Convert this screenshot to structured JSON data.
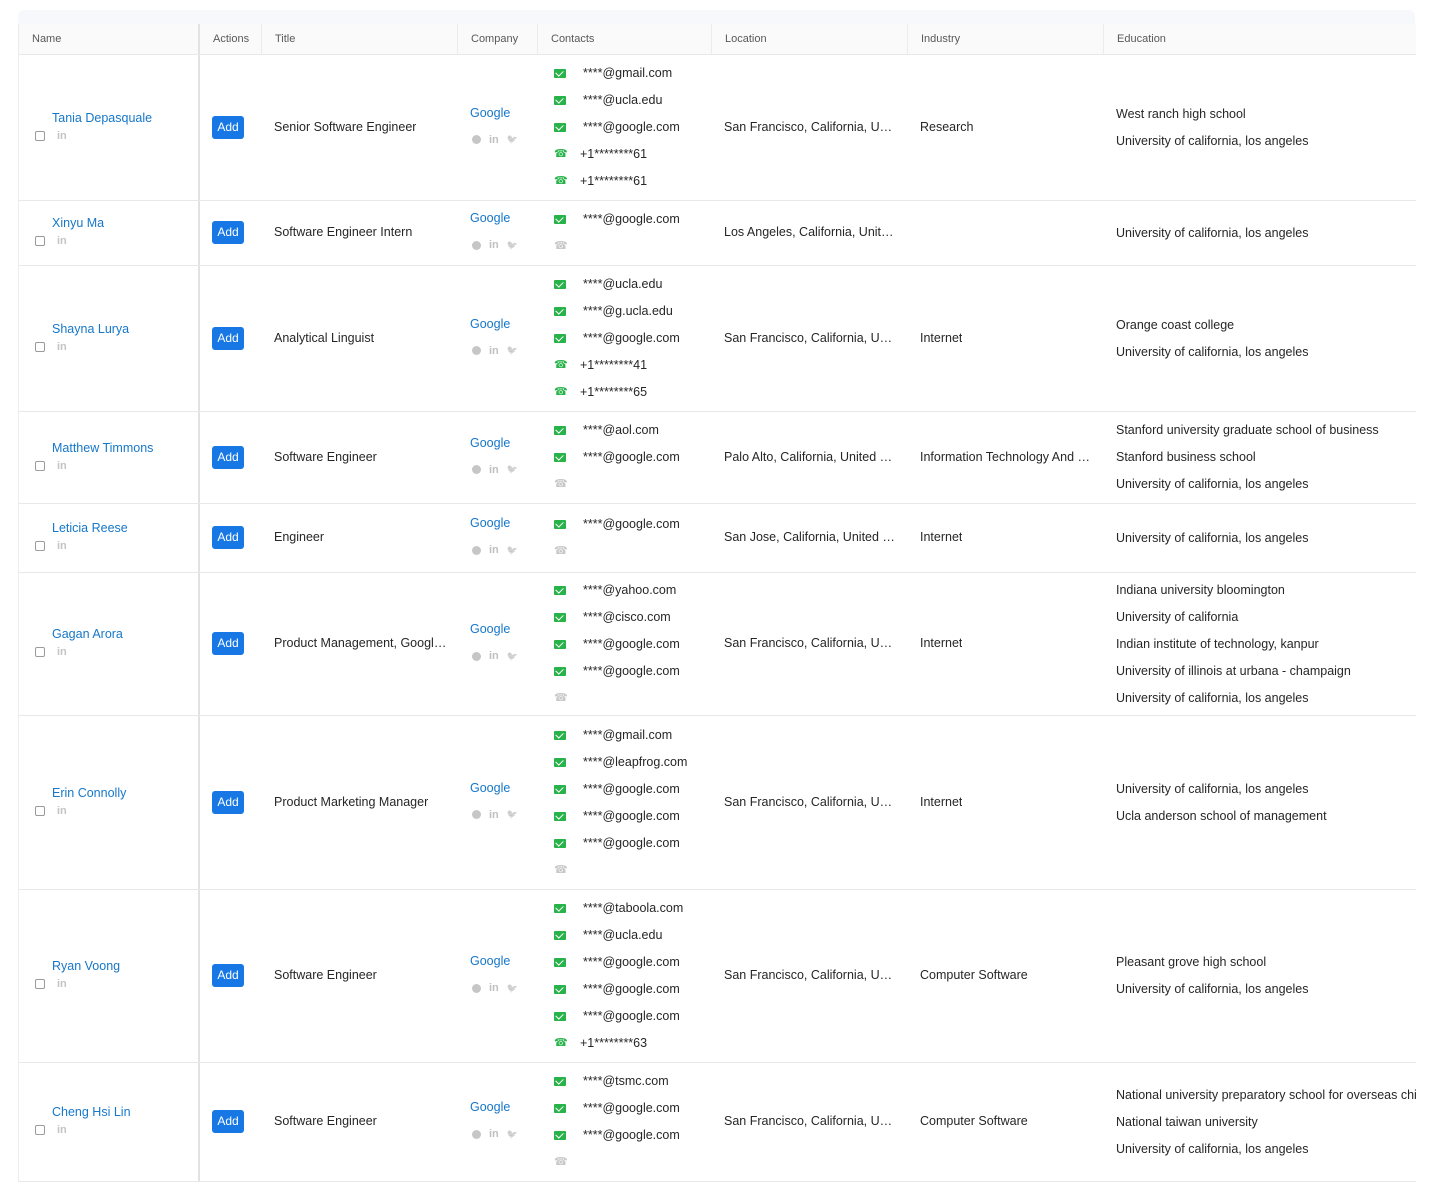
{
  "columns": [
    "Name",
    "Actions",
    "Title",
    "Company",
    "Contacts",
    "Location",
    "Industry",
    "Education"
  ],
  "add_label": "Add",
  "linkedin_label": "in",
  "rows": [
    {
      "name": "Tania Depasquale",
      "title": "Senior Software Engineer",
      "company": "Google",
      "contacts": [
        {
          "t": "mail",
          "v": "****@gmail.com"
        },
        {
          "t": "mail",
          "v": "****@ucla.edu"
        },
        {
          "t": "mail",
          "v": "****@google.com"
        },
        {
          "t": "phone",
          "v": "+1********61"
        },
        {
          "t": "phone",
          "v": "+1********61"
        }
      ],
      "location": "San Francisco, California, Un…",
      "industry": "Research",
      "education": [
        "West ranch high school",
        "University of california, los angeles"
      ]
    },
    {
      "name": "Xinyu Ma",
      "title": "Software Engineer Intern",
      "company": "Google",
      "contacts": [
        {
          "t": "mail",
          "v": "****@google.com"
        },
        {
          "t": "phone-empty",
          "v": ""
        }
      ],
      "location": "Los Angeles, California, Unit…",
      "industry": "",
      "education": [
        "University of california, los angeles"
      ]
    },
    {
      "name": "Shayna Lurya",
      "title": "Analytical Linguist",
      "company": "Google",
      "contacts": [
        {
          "t": "mail",
          "v": "****@ucla.edu"
        },
        {
          "t": "mail",
          "v": "****@g.ucla.edu"
        },
        {
          "t": "mail",
          "v": "****@google.com"
        },
        {
          "t": "phone",
          "v": "+1********41"
        },
        {
          "t": "phone",
          "v": "+1********65"
        }
      ],
      "location": "San Francisco, California, Un…",
      "industry": "Internet",
      "education": [
        "Orange coast college",
        "University of california, los angeles"
      ]
    },
    {
      "name": "Matthew Timmons",
      "title": "Software Engineer",
      "company": "Google",
      "contacts": [
        {
          "t": "mail",
          "v": "****@aol.com"
        },
        {
          "t": "mail",
          "v": "****@google.com"
        },
        {
          "t": "phone-empty",
          "v": ""
        }
      ],
      "location": "Palo Alto, California, United …",
      "industry": "Information Technology And …",
      "education": [
        "Stanford university graduate school of business",
        "Stanford business school",
        "University of california, los angeles"
      ]
    },
    {
      "name": "Leticia Reese",
      "title": "Engineer",
      "company": "Google",
      "contacts": [
        {
          "t": "mail",
          "v": "****@google.com"
        },
        {
          "t": "phone-empty",
          "v": ""
        }
      ],
      "location": "San Jose, California, United …",
      "industry": "Internet",
      "education": [
        "University of california, los angeles"
      ]
    },
    {
      "name": "Gagan Arora",
      "title": "Product Management, Googl…",
      "company": "Google",
      "contacts": [
        {
          "t": "mail",
          "v": "****@yahoo.com"
        },
        {
          "t": "mail",
          "v": "****@cisco.com"
        },
        {
          "t": "mail",
          "v": "****@google.com"
        },
        {
          "t": "mail",
          "v": "****@google.com"
        },
        {
          "t": "phone-empty",
          "v": ""
        }
      ],
      "location": "San Francisco, California, Un…",
      "industry": "Internet",
      "education": [
        "Indiana university bloomington",
        "University of california",
        "Indian institute of technology, kanpur",
        "University of illinois at urbana - champaign",
        "University of california, los angeles"
      ]
    },
    {
      "name": "Erin Connolly",
      "title": "Product Marketing Manager",
      "company": "Google",
      "contacts": [
        {
          "t": "mail",
          "v": "****@gmail.com"
        },
        {
          "t": "mail",
          "v": "****@leapfrog.com"
        },
        {
          "t": "mail",
          "v": "****@google.com"
        },
        {
          "t": "mail",
          "v": "****@google.com"
        },
        {
          "t": "mail",
          "v": "****@google.com"
        },
        {
          "t": "phone-empty",
          "v": ""
        }
      ],
      "location": "San Francisco, California, Un…",
      "industry": "Internet",
      "education": [
        "University of california, los angeles",
        "Ucla anderson school of management"
      ]
    },
    {
      "name": "Ryan Voong",
      "title": "Software Engineer",
      "company": "Google",
      "contacts": [
        {
          "t": "mail",
          "v": "****@taboola.com"
        },
        {
          "t": "mail",
          "v": "****@ucla.edu"
        },
        {
          "t": "mail",
          "v": "****@google.com"
        },
        {
          "t": "mail",
          "v": "****@google.com"
        },
        {
          "t": "mail",
          "v": "****@google.com"
        },
        {
          "t": "phone",
          "v": "+1********63"
        }
      ],
      "location": "San Francisco, California, Un…",
      "industry": "Computer Software",
      "education": [
        "Pleasant grove high school",
        "University of california, los angeles"
      ]
    },
    {
      "name": "Cheng Hsi Lin",
      "title": "Software Engineer",
      "company": "Google",
      "contacts": [
        {
          "t": "mail",
          "v": "****@tsmc.com"
        },
        {
          "t": "mail",
          "v": "****@google.com"
        },
        {
          "t": "mail",
          "v": "****@google.com"
        },
        {
          "t": "phone-empty",
          "v": ""
        }
      ],
      "location": "San Francisco, California, Un…",
      "industry": "Computer Software",
      "education": [
        "National university preparatory school for overseas chi",
        "National taiwan university",
        "University of california, los angeles"
      ]
    }
  ]
}
